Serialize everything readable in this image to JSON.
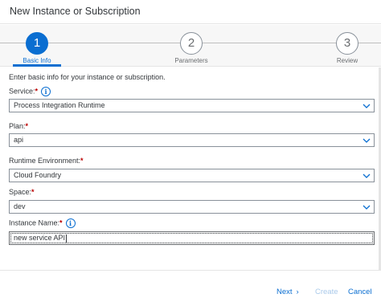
{
  "dialog": {
    "title": "New Instance or Subscription"
  },
  "wizard": {
    "steps": [
      {
        "number": "1",
        "label": "Basic Info",
        "active": true
      },
      {
        "number": "2",
        "label": "Parameters",
        "active": false
      },
      {
        "number": "3",
        "label": "Review",
        "active": false
      }
    ]
  },
  "form": {
    "intro": "Enter basic info for your instance or subscription.",
    "service": {
      "label": "Service:",
      "required_mark": "*",
      "value": "Process Integration Runtime"
    },
    "plan": {
      "label": "Plan:",
      "required_mark": "*",
      "value": "api"
    },
    "runtime": {
      "label": "Runtime Environment:",
      "required_mark": "*",
      "value": "Cloud Foundry"
    },
    "space": {
      "label": "Space:",
      "required_mark": "*",
      "value": "dev"
    },
    "instance_name": {
      "label": "Instance Name:",
      "required_mark": "*",
      "value": "new service API"
    },
    "info_glyph": "i"
  },
  "footer": {
    "next_label": "Next",
    "next_glyph": "›",
    "create_label": "Create",
    "cancel_label": "Cancel"
  },
  "colors": {
    "accent": "#0a6ed1",
    "required": "#bb0000",
    "disabled": "#a9c9ea"
  },
  "icons": {
    "info": "info-icon",
    "dropdown": "chevron-down-icon",
    "next": "chevron-right-icon"
  }
}
